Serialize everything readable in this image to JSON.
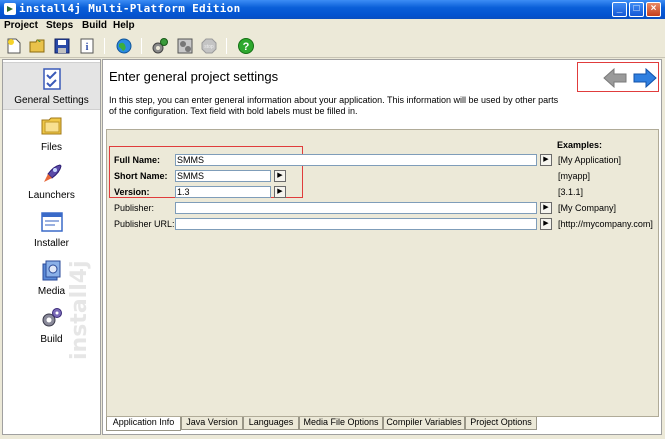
{
  "window": {
    "title": "install4j Multi-Platform Edition",
    "minimize_label": "_",
    "maximize_label": "□",
    "close_label": "×"
  },
  "menu": {
    "items": [
      {
        "label": "Project"
      },
      {
        "label": "Steps"
      },
      {
        "label": "Build"
      },
      {
        "label": "Help"
      }
    ]
  },
  "toolbar": {
    "icons": [
      "new-icon",
      "open-icon",
      "save-icon",
      "info-icon",
      "globe-icon",
      "build-gear-icon",
      "build-settings-icon",
      "stop-icon",
      "help-icon"
    ]
  },
  "sidebar": {
    "items": [
      {
        "label": "General Settings",
        "icon": "checklist-icon",
        "selected": true
      },
      {
        "label": "Files",
        "icon": "folder-icon"
      },
      {
        "label": "Launchers",
        "icon": "rocket-icon"
      },
      {
        "label": "Installer",
        "icon": "window-icon"
      },
      {
        "label": "Media",
        "icon": "media-icon"
      },
      {
        "label": "Build",
        "icon": "gears-icon"
      }
    ],
    "watermark": "install4j"
  },
  "page": {
    "title": "Enter general project settings",
    "description": "In this step, you can enter general information about your application. This information will be used by other parts of the configuration. Text field with bold labels must be filled in.",
    "nav": {
      "back": "back-arrow-icon",
      "next": "next-arrow-icon"
    }
  },
  "form": {
    "examples_header": "Examples:",
    "rows": [
      {
        "label": "Full Name:",
        "value": "SMMS",
        "example": "[My Application]",
        "required": true
      },
      {
        "label": "Short Name:",
        "value": "SMMS",
        "example": "[myapp]",
        "required": true
      },
      {
        "label": "Version:",
        "value": "1.3",
        "example": "[3.1.1]",
        "required": true
      },
      {
        "label": "Publisher:",
        "value": "",
        "example": "[My Company]",
        "required": false
      },
      {
        "label": "Publisher URL:",
        "value": "",
        "example": "[http://mycompany.com]",
        "required": false
      }
    ],
    "insert_button_label": "▶"
  },
  "tabs": [
    {
      "label": "Application Info",
      "active": true
    },
    {
      "label": "Java Version"
    },
    {
      "label": "Languages"
    },
    {
      "label": "Media File Options"
    },
    {
      "label": "Compiler Variables"
    },
    {
      "label": "Project Options"
    }
  ],
  "colors": {
    "titlebar": "#0a5fd8",
    "highlight_red": "#e03c3c",
    "arrow_blue": "#2f7fe0",
    "arrow_gray": "#9a9a9a"
  }
}
